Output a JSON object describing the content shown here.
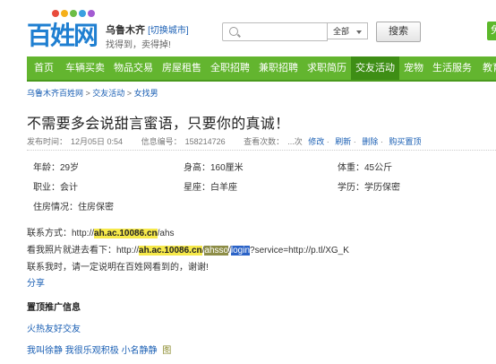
{
  "header": {
    "logo_text": "百姓网",
    "city": "乌鲁木齐",
    "switch_city": "[切换城市]",
    "slogan": "找得到，卖得掉!",
    "search_placeholder": "",
    "category_selected": "全部",
    "search_button": "搜索",
    "post_button": "免费发布"
  },
  "nav": {
    "items": [
      "首页",
      "车辆买卖",
      "物品交易",
      "房屋租售",
      "全职招聘",
      "兼职招聘",
      "求职简历",
      "交友活动",
      "宠物",
      "生活服务",
      "教育"
    ],
    "active_index": 7
  },
  "breadcrumb": [
    "乌鲁木齐百姓网",
    "交友活动",
    "女找男"
  ],
  "post": {
    "title": "不需要多会说甜言蜜语，只要你的真诚！",
    "published_label": "发布时间：",
    "published_value": "12月05日 0:54",
    "id_label": "信息编号：",
    "id_value": "158214726",
    "views_label": "查看次数：",
    "views_value": "...次",
    "action_edit": "修改",
    "action_refresh": "刷新",
    "action_delete": "删除",
    "action_promote": "购买置顶"
  },
  "info": {
    "age_label": "年龄：",
    "age_value": "29岁",
    "height_label": "身高：",
    "height_value": "160厘米",
    "weight_label": "体重：",
    "weight_value": "45公斤",
    "job_label": "职业：",
    "job_value": "会计",
    "sign_label": "星座：",
    "sign_value": "白羊座",
    "edu_label": "学历：",
    "edu_value": "学历保密",
    "housing_label": "住房情况：",
    "housing_value": "住房保密"
  },
  "contact": {
    "contact_label": "联系方式：",
    "contact_prefix": "http://",
    "contact_domain": "ah.ac.10086.cn",
    "contact_suffix": "/ahs",
    "photo_label": "看我照片就进去看下：",
    "photo_prefix": "http://",
    "photo_domain": "ah.ac.10086.cn",
    "photo_slash": "/",
    "photo_ahsso": "ahsso",
    "photo_slash2": "/",
    "photo_login": "login",
    "photo_suffix": "?service=http://p.tl/XG_K",
    "note": "联系我时，请一定说明在百姓网看到的，谢谢!",
    "share": "分享"
  },
  "promo": {
    "title": "置顶推广信息",
    "links": [
      "火热友好交友",
      "我叫徐静",
      "我很乐观积极",
      "小名静静"
    ],
    "img_tag": "图"
  },
  "colors": {
    "nav_green": "#63b52f",
    "nav_active": "#3e8e15",
    "link_blue": "#1a5fb4",
    "logo_blue": "#1f7fd1"
  }
}
